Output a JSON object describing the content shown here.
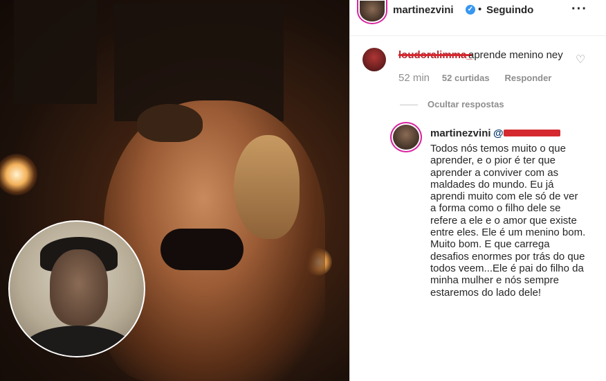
{
  "header": {
    "username": "martinezvini",
    "verified_glyph": "✓",
    "separator": "•",
    "follow_status": "Seguindo",
    "more_glyph": "···"
  },
  "comment": {
    "username_redacted": "loudoralimma_",
    "text": "aprende menino ney",
    "time": "52 min",
    "likes": "52 curtidas",
    "reply_label": "Responder",
    "heart_glyph": "♡"
  },
  "hide_replies_label": "Ocultar respostas",
  "reply": {
    "username": "martinezvini",
    "mention": "@",
    "text": "Todos nós temos muito o que aprender, e o pior é ter que aprender a conviver com as maldades do mundo. Eu já aprendi muito com ele só de ver a forma como o filho dele se refere a ele e o amor que existe entre eles. Ele é um menino bom. Muito bom. E que carrega desafios enormes por trás do que todos veem...Ele é pai do filho da minha mulher e nós sempre estaremos do lado dele!"
  },
  "icons": {
    "verified": "verified-badge-icon",
    "more": "more-options-icon",
    "heart": "heart-icon"
  },
  "colors": {
    "verified_blue": "#3897f0",
    "redaction_red": "#d42a2f",
    "muted_gray": "#8e8e8e",
    "mention_blue": "#00376b"
  }
}
